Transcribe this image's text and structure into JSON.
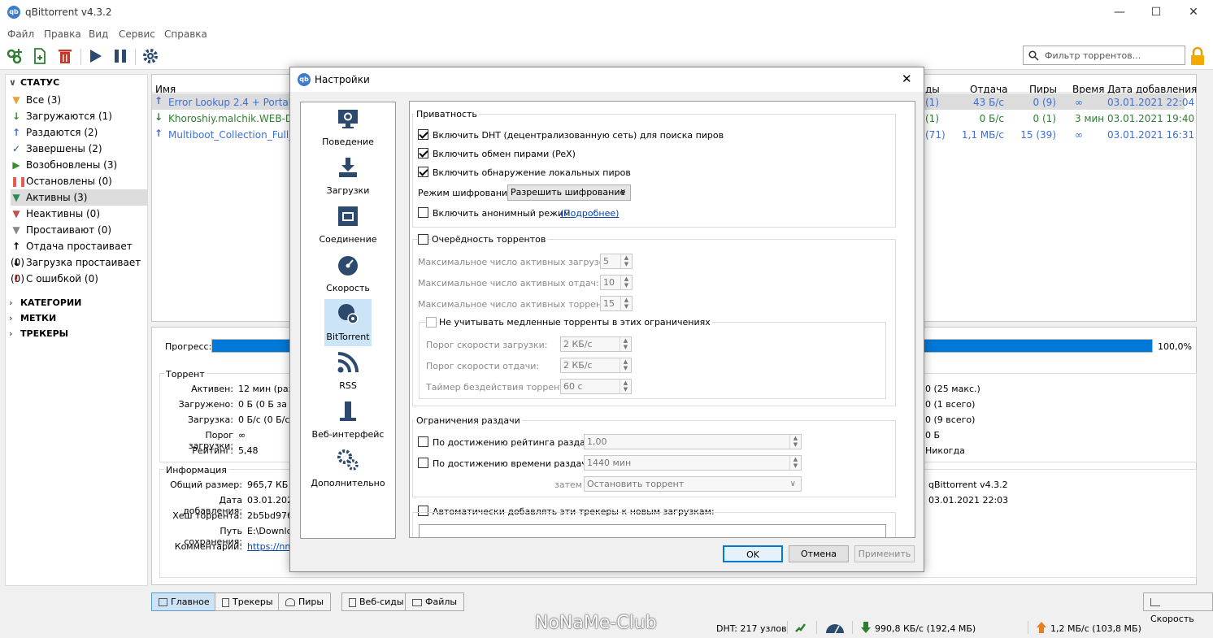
{
  "window": {
    "title": "qBittorrent v4.3.2",
    "app_icon": "qb"
  },
  "menu": [
    "Файл",
    "Правка",
    "Вид",
    "Сервис",
    "Справка"
  ],
  "toolbar": {
    "filter_placeholder": "Фильтр торрентов..."
  },
  "sidebar": {
    "status_header": "СТАТУС",
    "items": [
      {
        "label": "Все (3)",
        "icon": "filter-icon",
        "color": "#e8a33c"
      },
      {
        "label": "Загружаются (1)",
        "icon": "download-arrow-icon",
        "color": "#3c8d2f"
      },
      {
        "label": "Раздаются (2)",
        "icon": "upload-arrow-icon",
        "color": "#3d6fd6"
      },
      {
        "label": "Завершены (2)",
        "icon": "check-icon",
        "color": "#2b4a6e"
      },
      {
        "label": "Возобновлены (3)",
        "icon": "play-icon",
        "color": "#3c8d2f"
      },
      {
        "label": "Остановлены (0)",
        "icon": "pause-icon",
        "color": "#e55b4c"
      },
      {
        "label": "Активны (3)",
        "icon": "filter-icon",
        "color": "#2e8b57"
      },
      {
        "label": "Неактивны (0)",
        "icon": "filter-icon",
        "color": "#c0504d"
      },
      {
        "label": "Простаивают (0)",
        "icon": "filter-icon",
        "color": "#888888"
      },
      {
        "label": "Отдача простаивает (0)",
        "icon": "up-arrow-icon",
        "color": "#000000"
      },
      {
        "label": "Загрузка простаивает (0)",
        "icon": "down-arrow-icon",
        "color": "#000000"
      },
      {
        "label": "С ошибкой (0)",
        "icon": "error-icon",
        "color": "#d00000"
      }
    ],
    "categories": "КАТЕГОРИИ",
    "tags": "МЕТКИ",
    "trackers": "ТРЕКЕРЫ"
  },
  "torrents": {
    "headers": {
      "name": "Имя",
      "ds": "ды",
      "upload": "Отдача",
      "peers": "Пиры",
      "time": "Время",
      "added": "Дата добавления"
    },
    "rows": [
      {
        "name": "Error Lookup 2.4 + Portable",
        "seeds": "(1)",
        "upload": "43 Б/с",
        "peers": "0 (9)",
        "time": "∞",
        "added": "03.01.2021 22:04",
        "status": "seeding"
      },
      {
        "name": "Khoroshiy.malchik.WEB-DL.",
        "seeds": "(1)",
        "upload": "0 Б/с",
        "peers": "0 (1)",
        "time": "3 мин",
        "added": "03.01.2021 19:40",
        "status": "downloading"
      },
      {
        "name": "Multiboot_Collection_Full_v.",
        "seeds": "(71)",
        "upload": "1,1 МБ/с",
        "peers": "15 (39)",
        "time": "∞",
        "added": "03.01.2021 16:31",
        "status": "seeding"
      }
    ]
  },
  "details": {
    "progress_label": "Прогресс:",
    "progress_value": "100,0%",
    "torrent_group": "Торрент",
    "active_label": "Активен:",
    "active_val": "12 мин (разд",
    "downloaded_label": "Загружено:",
    "downloaded_val": "0 Б (0 Б за се",
    "dl_label": "Загрузка:",
    "dl_val": "0 Б/с (0 Б/с с",
    "dl_limit_label": "Порог загрузки:",
    "dl_limit_val": "∞",
    "ratio_label": "Рейтинг:",
    "ratio_val": "5,48",
    "right_vals": [
      "0 (25 макс.)",
      "0 (1 всего)",
      "0 (9 всего)",
      "0 Б",
      "Никогда"
    ],
    "info_group": "Информация",
    "size_label": "Общий размер:",
    "size_val": "965,7 КБ",
    "added_label": "Дата добавления:",
    "added_val": "03.01.202",
    "hash_label": "Хеш торрента:",
    "hash_val": "2b5bd9765",
    "path_label": "Путь сохранения:",
    "path_val": "E:\\Downlo",
    "comment_label": "Комментарий:",
    "comment_val": "https://nnm",
    "created_by": "qBittorrent v4.3.2",
    "created_on": "03.01.2021 22:03"
  },
  "bottom_tabs": [
    "Главное",
    "Трекеры",
    "Пиры",
    "Веб-сиды",
    "Файлы"
  ],
  "speed_tab": "Скорость",
  "statusbar": {
    "watermark": "NoNaMe-Club",
    "dht": "DHT: 217 узлов",
    "download": "990,8 КБ/с (192,4 МБ)",
    "upload": "1,2 МБ/с (103,8 МБ)"
  },
  "dialog": {
    "title": "Настройки",
    "nav": [
      "Поведение",
      "Загрузки",
      "Соединение",
      "Скорость",
      "BitTorrent",
      "RSS",
      "Веб-интерфейс",
      "Дополнительно"
    ],
    "privacy": {
      "title": "Приватность",
      "dht": "Включить DHT (децентрализованную сеть) для поиска пиров",
      "pex": "Включить обмен пирами (PeX)",
      "lsd": "Включить обнаружение локальных пиров",
      "enc_label": "Режим шифрования:",
      "enc_value": "Разрешить шифрование",
      "anon": "Включить анонимный режим",
      "more": "(Подробнее)"
    },
    "queue": {
      "title": "Очерёдность торрентов",
      "max_dl": "Максимальное число активных загрузок:",
      "max_dl_val": "5",
      "max_ul": "Максимальное число активных отдач:",
      "max_ul_val": "10",
      "max_t": "Максимальное число активных торрентов:",
      "max_t_val": "15",
      "slow": "Не учитывать медленные торренты в этих ограничениях",
      "dl_thr": "Порог скорости загрузки:",
      "dl_thr_val": "2 КБ/с",
      "ul_thr": "Порог скорости отдачи:",
      "ul_thr_val": "2 КБ/с",
      "idle": "Таймер бездействия торрента:",
      "idle_val": "60 с"
    },
    "seed": {
      "title": "Ограничения раздачи",
      "ratio": "По достижению рейтинга раздачи",
      "ratio_val": "1,00",
      "time": "По достижению времени раздачи",
      "time_val": "1440 мин",
      "then": "затем",
      "then_val": "Остановить торрент"
    },
    "trackers": "Автоматически добавлять эти трекеры к новым загрузкам:",
    "buttons": {
      "ok": "OK",
      "cancel": "Отмена",
      "apply": "Применить"
    }
  }
}
